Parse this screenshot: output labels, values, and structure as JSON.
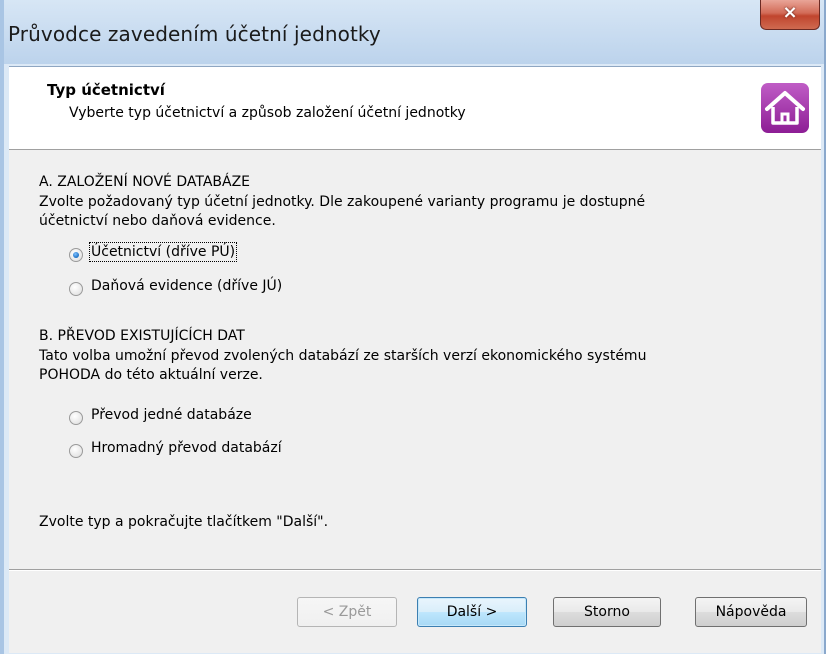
{
  "window": {
    "title": "Průvodce zavedením účetní jednotky",
    "close_glyph": "×"
  },
  "header": {
    "title": "Typ účetnictví",
    "subtitle": "Vyberte typ účetnictví a způsob založení účetní jednotky",
    "icon": "house-icon",
    "icon_color": "#9b2aa3"
  },
  "section_a": {
    "heading": "A. ZALOŽENÍ NOVÉ DATABÁZE",
    "description_line1": "Zvolte požadovaný typ účetní jednotky. Dle zakoupené varianty programu je dostupné",
    "description_line2": "účetnictví nebo daňová evidence.",
    "options": [
      {
        "label": "Účetnictví  (dříve PÚ)",
        "checked": true
      },
      {
        "label": "Daňová evidence  (dříve JÚ)",
        "checked": false
      }
    ]
  },
  "section_b": {
    "heading": "B. PŘEVOD EXISTUJÍCÍCH DAT",
    "description_line1": "Tato volba umožní převod zvolených databází ze starších verzí ekonomického systému",
    "description_line2": "POHODA do této aktuální verze.",
    "options": [
      {
        "label": "Převod jedné databáze",
        "checked": false
      },
      {
        "label": "Hromadný převod databází",
        "checked": false
      }
    ]
  },
  "footer_hint": "Zvolte typ a pokračujte tlačítkem \"Další\".",
  "buttons": {
    "back": "< Zpět",
    "next": "Další >",
    "cancel": "Storno",
    "help": "Nápověda"
  }
}
